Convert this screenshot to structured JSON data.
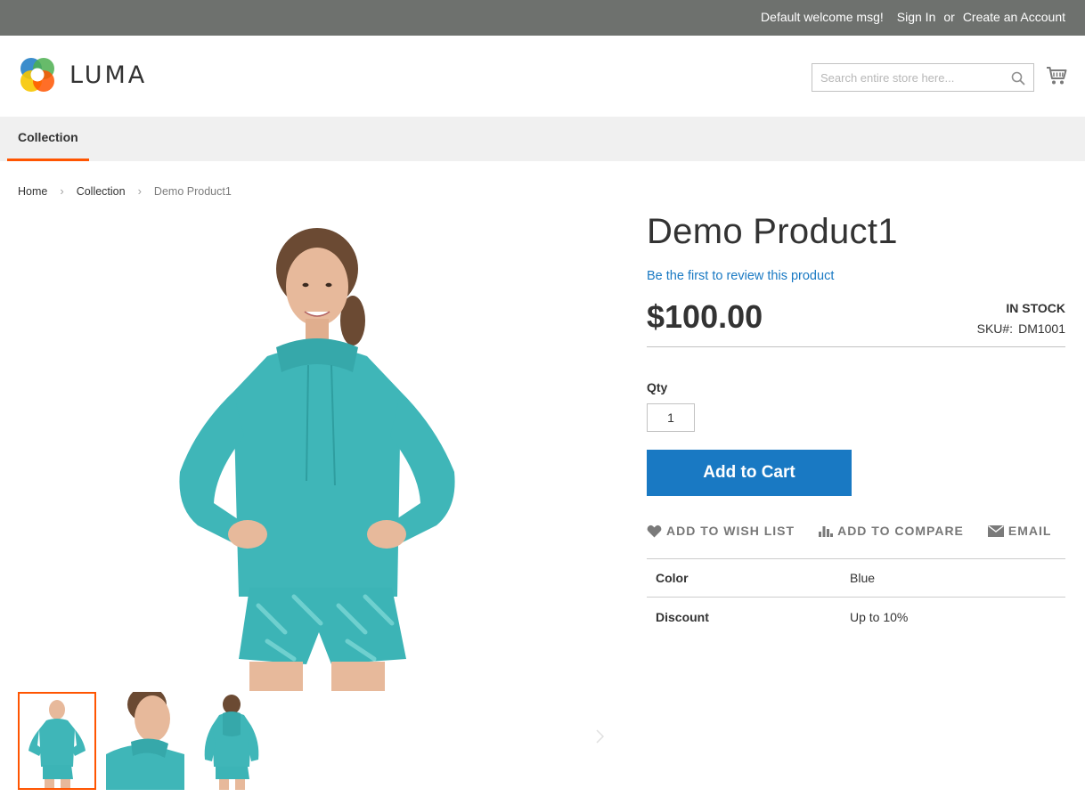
{
  "top_panel": {
    "welcome": "Default welcome msg!",
    "sign_in": "Sign In",
    "or": "or",
    "create_account": "Create an Account"
  },
  "header": {
    "logo_text": "LUMA",
    "search_placeholder": "Search entire store here...",
    "search_icon": "magnifier-icon",
    "cart_icon": "shopping-cart-icon"
  },
  "nav": {
    "items": [
      {
        "label": "Collection",
        "active": true
      }
    ]
  },
  "breadcrumb": {
    "items": [
      "Home",
      "Collection",
      "Demo Product1"
    ]
  },
  "product": {
    "title": "Demo Product1",
    "review_link": "Be the first to review this product",
    "price": "$100.00",
    "stock": "IN STOCK",
    "sku_label": "SKU#:",
    "sku_value": "DM1001",
    "qty_label": "Qty",
    "qty_value": "1",
    "add_to_cart": "Add to Cart",
    "actions": {
      "wish": "ADD TO WISH LIST",
      "compare": "ADD TO COMPARE",
      "email": "EMAIL"
    },
    "attributes": [
      {
        "label": "Color",
        "value": "Blue"
      },
      {
        "label": "Discount",
        "value": "Up to 10%"
      }
    ]
  },
  "colors": {
    "accent_orange": "#ff5501",
    "link_blue": "#1979c3",
    "top_panel_bg": "#6e716e",
    "nav_bg": "#f0f0f0",
    "product_teal": "#3fb6b8"
  }
}
